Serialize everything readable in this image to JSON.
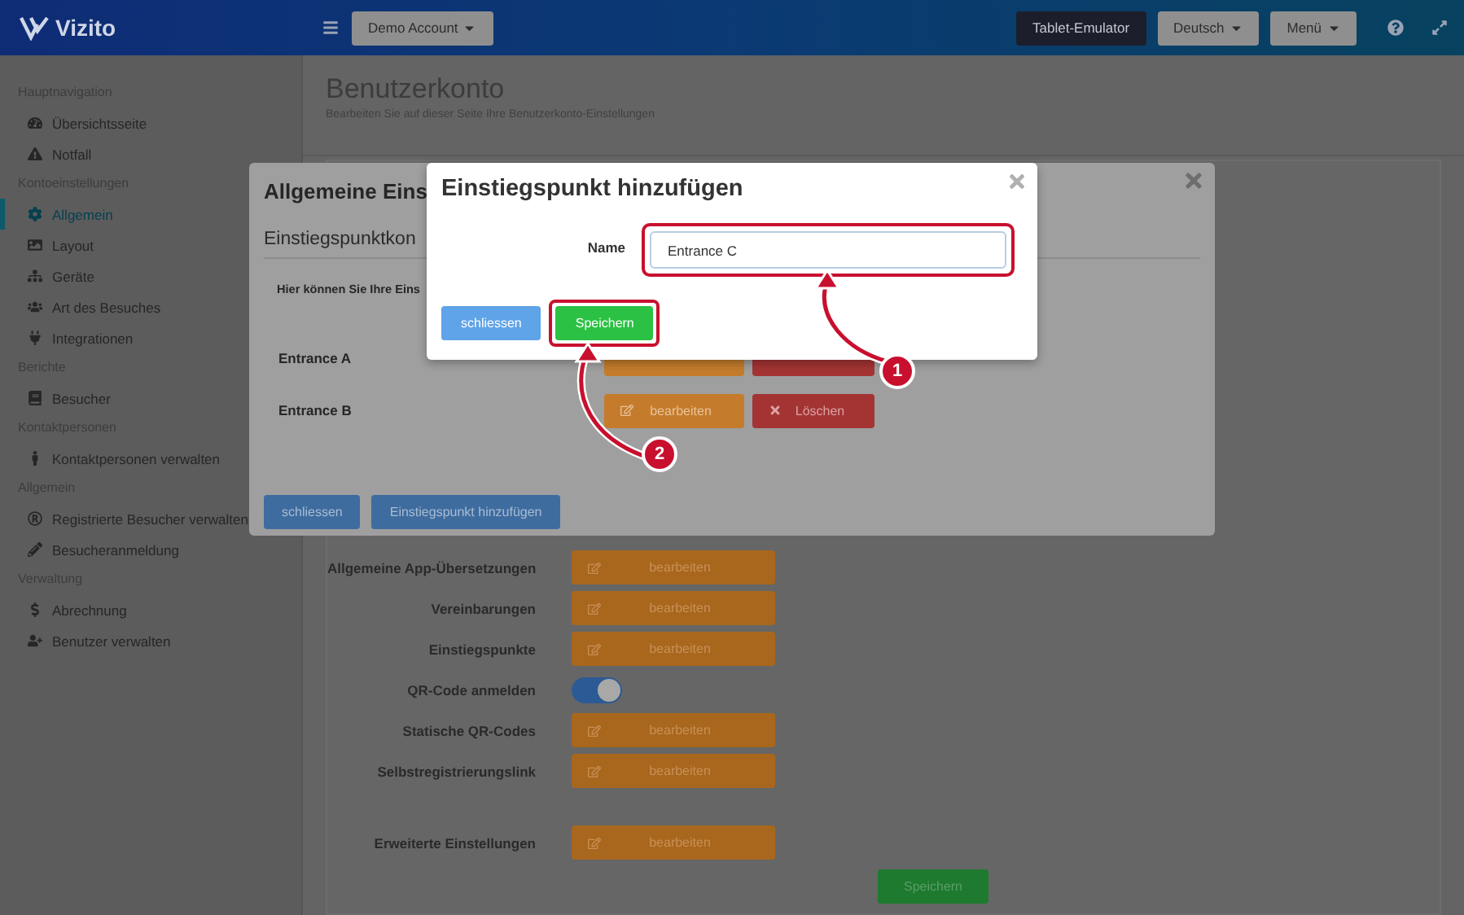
{
  "topbar": {
    "logo": "Vizito",
    "account": "Demo Account",
    "buttons": [
      {
        "label": "Tablet-Emulator",
        "kind": "dark"
      },
      {
        "label": "Deutsch",
        "kind": "dropdown"
      },
      {
        "label": "Menü",
        "kind": "dropdown"
      }
    ]
  },
  "sidebar": {
    "sections": [
      {
        "title": "Hauptnavigation",
        "items": [
          {
            "label": "Übersichtsseite",
            "selected": false
          },
          {
            "label": "Notfall",
            "selected": false
          }
        ]
      },
      {
        "title": "Kontoeinstellungen",
        "items": [
          {
            "label": "Allgemein",
            "selected": true
          },
          {
            "label": "Layout",
            "selected": false
          },
          {
            "label": "Geräte",
            "selected": false
          },
          {
            "label": "Art des Besuches",
            "selected": false
          },
          {
            "label": "Integrationen",
            "selected": false
          }
        ]
      },
      {
        "title": "Berichte",
        "items": [
          {
            "label": "Besucher",
            "selected": false
          }
        ]
      },
      {
        "title": "Kontaktpersonen",
        "items": [
          {
            "label": "Kontaktpersonen verwalten",
            "selected": false
          }
        ]
      },
      {
        "title": "Allgemein",
        "items": [
          {
            "label": "Registrierte Besucher verwalten",
            "selected": false
          },
          {
            "label": "Besucheranmeldung",
            "selected": false
          }
        ]
      },
      {
        "title": "Verwaltung",
        "items": [
          {
            "label": "Abrechnung",
            "selected": false
          },
          {
            "label": "Benutzer verwalten",
            "selected": false
          }
        ]
      }
    ]
  },
  "page": {
    "title": "Benutzerkonto",
    "subtitle": "Bearbeiten Sie auf dieser Seite Ihre Benutzerkonto-Einstellungen",
    "rows": [
      {
        "label": "Allgemeine App-Übersetzungen",
        "kind": "button",
        "button": "bearbeiten"
      },
      {
        "label": "Vereinbarungen",
        "kind": "button",
        "button": "bearbeiten"
      },
      {
        "label": "Einstiegspunkte",
        "kind": "button",
        "button": "bearbeiten"
      },
      {
        "label": "QR-Code anmelden",
        "kind": "toggle",
        "on": true
      },
      {
        "label": "Statische QR-Codes",
        "kind": "button",
        "button": "bearbeiten"
      },
      {
        "label": "Selbstregistrierungslink",
        "kind": "button",
        "button": "bearbeiten"
      }
    ],
    "advanced_rows": [
      {
        "label": "Erweiterte Einstellungen",
        "kind": "button",
        "button": "bearbeiten"
      }
    ],
    "save": "Speichern"
  },
  "dialog": {
    "title": "Allgemeine Eins",
    "subtitle": "Einstiegspunktkon",
    "intro": "Hier können Sie Ihre Eins",
    "entries": [
      {
        "name": "Entrance A"
      },
      {
        "name": "Entrance B",
        "edit": "bearbeiten",
        "delete": "Löschen"
      }
    ],
    "buttons": [
      {
        "label": "schliessen"
      },
      {
        "label": "Einstiegspunkt hinzufügen"
      }
    ]
  },
  "add_dialog": {
    "title": "Einstiegspunkt hinzufügen",
    "field_label": "Name",
    "field_value": "Entrance C",
    "field_highlighted": true,
    "buttons": [
      {
        "label": "schliessen",
        "kind": "secondary",
        "highlighted": false
      },
      {
        "label": "Speichern",
        "kind": "primary",
        "highlighted": true
      }
    ]
  },
  "annotations": [
    {
      "number": "1"
    },
    {
      "number": "2"
    }
  ]
}
